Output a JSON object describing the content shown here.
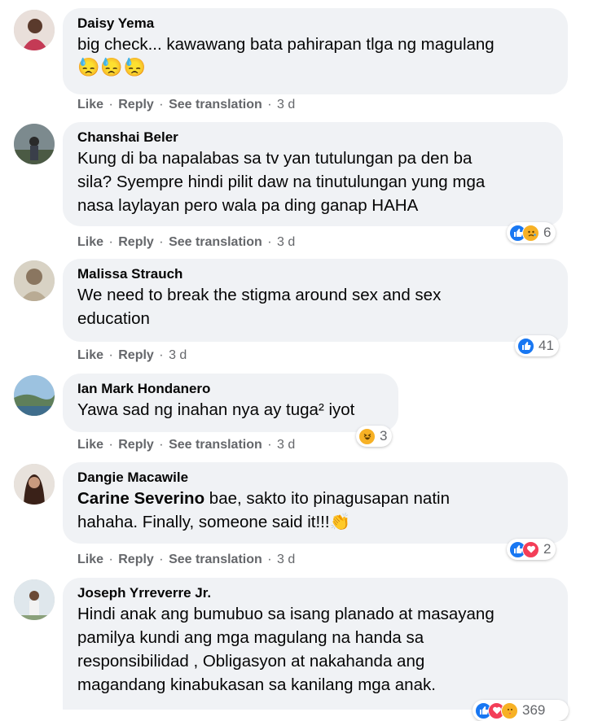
{
  "actions": {
    "like": "Like",
    "reply": "Reply",
    "translate": "See translation",
    "sep": "·"
  },
  "comments": [
    {
      "author": "Daisy Yema",
      "lines": [
        "big check... kawawang bata pahirapan tlga ng magulang"
      ],
      "emoji": "😓😓😓",
      "time": "3 d",
      "reactions": []
    },
    {
      "author": "Chanshai Beler",
      "lines": [
        "Kung di ba napalabas sa tv yan tutulungan pa den ba",
        "sila? Syempre hindi pilit daw na tinutulungan yung mga",
        "nasa laylayan pero wala pa ding ganap HAHA"
      ],
      "time": "3 d",
      "reactions": [
        "like-icon",
        "sad-icon"
      ],
      "reaction_count": "6"
    },
    {
      "author": "Malissa Strauch",
      "lines": [
        "We need to break the stigma around sex and sex",
        "education"
      ],
      "time": "3 d",
      "reactions": [
        "like-icon"
      ],
      "reaction_count": "41"
    },
    {
      "author": "Ian Mark Hondanero",
      "lines": [
        "Yawa sad ng inahan nya ay tuga² iyot"
      ],
      "time": "3 d",
      "reactions": [
        "haha-icon"
      ],
      "reaction_count": "3"
    },
    {
      "author": "Dangie Macawile",
      "tag": "Carine Severino",
      "lines": [
        " bae, sakto ito pinagusapan natin",
        "hahaha. Finally, someone said it!!!👏"
      ],
      "time": "3 d",
      "reactions": [
        "like-icon",
        "heart-icon"
      ],
      "reaction_count": "2"
    },
    {
      "author": "Joseph Yrreverre Jr.",
      "lines": [
        "Hindi anak ang bumubuo sa isang planado at masayang",
        "pamilya kundi ang mga magulang na handa sa",
        "responsibilidad , Obligasyon at nakahanda ang",
        "magandang kinabukasan sa kanilang mga anak."
      ],
      "reactions": [
        "like-icon",
        "heart-icon",
        "care-icon"
      ],
      "reaction_count": "369"
    }
  ]
}
